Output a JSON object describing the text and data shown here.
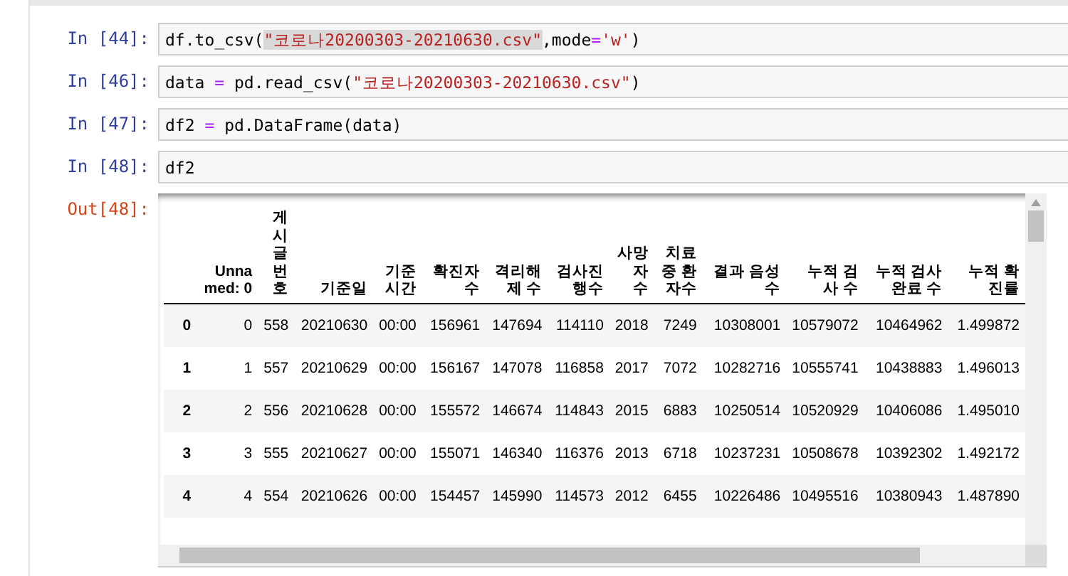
{
  "cells": [
    {
      "prompt": "In [44]:",
      "code": [
        {
          "kind": "plain",
          "text": "df.to_csv(",
          "highlighted": false
        },
        {
          "kind": "string",
          "text": "\"코로나20200303-20210630.csv\"",
          "highlighted": true
        },
        {
          "kind": "plain",
          "text": ",mode",
          "highlighted": false
        },
        {
          "kind": "operator",
          "text": "=",
          "highlighted": false
        },
        {
          "kind": "string",
          "text": "'w'",
          "highlighted": false
        },
        {
          "kind": "plain",
          "text": ")",
          "highlighted": false
        }
      ]
    },
    {
      "prompt": "In [46]:",
      "code": [
        {
          "kind": "plain",
          "text": "data ",
          "highlighted": false
        },
        {
          "kind": "operator",
          "text": "=",
          "highlighted": false
        },
        {
          "kind": "plain",
          "text": " pd.read_csv(",
          "highlighted": false
        },
        {
          "kind": "string",
          "text": "\"코로나20200303-20210630.csv\"",
          "highlighted": false
        },
        {
          "kind": "plain",
          "text": ")",
          "highlighted": false
        }
      ]
    },
    {
      "prompt": "In [47]:",
      "code": [
        {
          "kind": "plain",
          "text": "df2 ",
          "highlighted": false
        },
        {
          "kind": "operator",
          "text": "=",
          "highlighted": false
        },
        {
          "kind": "plain",
          "text": " pd.DataFrame(data)",
          "highlighted": false
        }
      ]
    },
    {
      "prompt": "In [48]:",
      "code": [
        {
          "kind": "plain",
          "text": "df2",
          "highlighted": false
        }
      ]
    }
  ],
  "output": {
    "prompt": "Out[48]:",
    "table": {
      "columns": [
        "Unnamed: 0",
        "게시글번호",
        "기준일",
        "기준 시간",
        "확진자 수",
        "격리해 제 수",
        "검사진 행수",
        "사망 자 수",
        "치료 중 환 자수",
        "결과 음성 수",
        "누적 검사 수",
        "누적 검사 완료 수",
        "누적 확 진률"
      ],
      "rows": [
        {
          "index": "0",
          "cells": [
            "0",
            "558",
            "20210630",
            "00:00",
            "156961",
            "147694",
            "114110",
            "2018",
            "7249",
            "10308001",
            "10579072",
            "10464962",
            "1.499872"
          ]
        },
        {
          "index": "1",
          "cells": [
            "1",
            "557",
            "20210629",
            "00:00",
            "156167",
            "147078",
            "116858",
            "2017",
            "7072",
            "10282716",
            "10555741",
            "10438883",
            "1.496013"
          ]
        },
        {
          "index": "2",
          "cells": [
            "2",
            "556",
            "20210628",
            "00:00",
            "155572",
            "146674",
            "114843",
            "2015",
            "6883",
            "10250514",
            "10520929",
            "10406086",
            "1.495010"
          ]
        },
        {
          "index": "3",
          "cells": [
            "3",
            "555",
            "20210627",
            "00:00",
            "155071",
            "146340",
            "116376",
            "2013",
            "6718",
            "10237231",
            "10508678",
            "10392302",
            "1.492172"
          ]
        },
        {
          "index": "4",
          "cells": [
            "4",
            "554",
            "20210626",
            "00:00",
            "154457",
            "145990",
            "114573",
            "2012",
            "6455",
            "10226486",
            "10495516",
            "10380943",
            "1.487890"
          ]
        }
      ]
    }
  }
}
